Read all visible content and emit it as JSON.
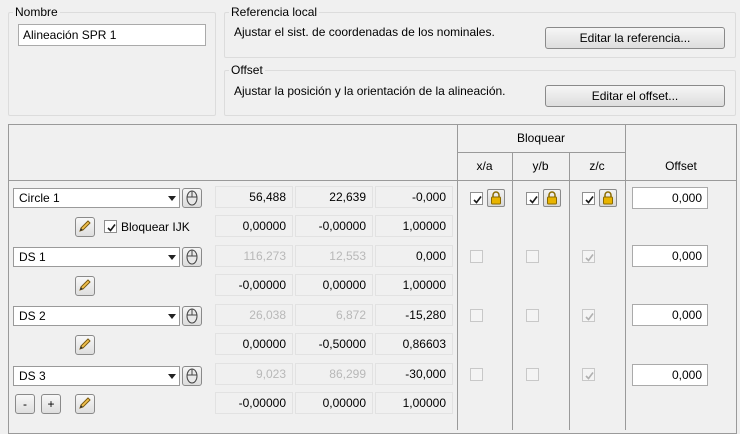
{
  "nombre": {
    "label": "Nombre",
    "value": "Alineación SPR 1"
  },
  "referencia": {
    "label": "Referencia local",
    "description": "Ajustar el sist. de coordenadas de los nominales.",
    "button": "Editar la referencia..."
  },
  "offset_group": {
    "label": "Offset",
    "description": "Ajustar la posición y la orientación de la alineación.",
    "button": "Editar el offset..."
  },
  "table": {
    "bloquear_header": "Bloquear",
    "col_xa": "x/a",
    "col_yb": "y/b",
    "col_zc": "z/c",
    "col_offset": "Offset",
    "bloquear_ijk_label": "Bloquear IJK",
    "rows": [
      {
        "element": "Circle 1",
        "xyz": [
          "56,488",
          "22,639",
          "-0,000"
        ],
        "ijk": [
          "0,00000",
          "-0,00000",
          "1,00000"
        ],
        "offset": "0,000"
      },
      {
        "element": "DS 1",
        "xyz": [
          "116,273",
          "12,553",
          "0,000"
        ],
        "ijk": [
          "-0,00000",
          "0,00000",
          "1,00000"
        ],
        "offset": "0,000"
      },
      {
        "element": "DS 2",
        "xyz": [
          "26,038",
          "6,872",
          "-15,280"
        ],
        "ijk": [
          "0,00000",
          "-0,50000",
          "0,86603"
        ],
        "offset": "0,000"
      },
      {
        "element": "DS 3",
        "xyz": [
          "9,023",
          "86,299",
          "-30,000"
        ],
        "ijk": [
          "-0,00000",
          "0,00000",
          "1,00000"
        ],
        "offset": "0,000"
      }
    ],
    "remove_label": "-",
    "add_label": "+"
  },
  "colors": {
    "lock": "#e8b400",
    "check": "#1a1a1a"
  }
}
